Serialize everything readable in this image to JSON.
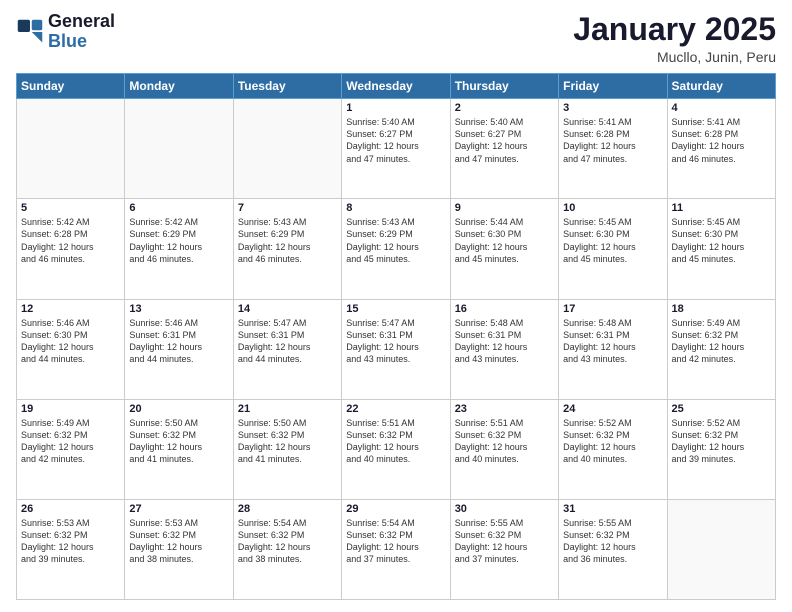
{
  "logo": {
    "line1": "General",
    "line2": "Blue"
  },
  "title": "January 2025",
  "subtitle": "Mucllo, Junin, Peru",
  "days_of_week": [
    "Sunday",
    "Monday",
    "Tuesday",
    "Wednesday",
    "Thursday",
    "Friday",
    "Saturday"
  ],
  "weeks": [
    [
      {
        "day": "",
        "info": ""
      },
      {
        "day": "",
        "info": ""
      },
      {
        "day": "",
        "info": ""
      },
      {
        "day": "1",
        "info": "Sunrise: 5:40 AM\nSunset: 6:27 PM\nDaylight: 12 hours\nand 47 minutes."
      },
      {
        "day": "2",
        "info": "Sunrise: 5:40 AM\nSunset: 6:27 PM\nDaylight: 12 hours\nand 47 minutes."
      },
      {
        "day": "3",
        "info": "Sunrise: 5:41 AM\nSunset: 6:28 PM\nDaylight: 12 hours\nand 47 minutes."
      },
      {
        "day": "4",
        "info": "Sunrise: 5:41 AM\nSunset: 6:28 PM\nDaylight: 12 hours\nand 46 minutes."
      }
    ],
    [
      {
        "day": "5",
        "info": "Sunrise: 5:42 AM\nSunset: 6:28 PM\nDaylight: 12 hours\nand 46 minutes."
      },
      {
        "day": "6",
        "info": "Sunrise: 5:42 AM\nSunset: 6:29 PM\nDaylight: 12 hours\nand 46 minutes."
      },
      {
        "day": "7",
        "info": "Sunrise: 5:43 AM\nSunset: 6:29 PM\nDaylight: 12 hours\nand 46 minutes."
      },
      {
        "day": "8",
        "info": "Sunrise: 5:43 AM\nSunset: 6:29 PM\nDaylight: 12 hours\nand 45 minutes."
      },
      {
        "day": "9",
        "info": "Sunrise: 5:44 AM\nSunset: 6:30 PM\nDaylight: 12 hours\nand 45 minutes."
      },
      {
        "day": "10",
        "info": "Sunrise: 5:45 AM\nSunset: 6:30 PM\nDaylight: 12 hours\nand 45 minutes."
      },
      {
        "day": "11",
        "info": "Sunrise: 5:45 AM\nSunset: 6:30 PM\nDaylight: 12 hours\nand 45 minutes."
      }
    ],
    [
      {
        "day": "12",
        "info": "Sunrise: 5:46 AM\nSunset: 6:30 PM\nDaylight: 12 hours\nand 44 minutes."
      },
      {
        "day": "13",
        "info": "Sunrise: 5:46 AM\nSunset: 6:31 PM\nDaylight: 12 hours\nand 44 minutes."
      },
      {
        "day": "14",
        "info": "Sunrise: 5:47 AM\nSunset: 6:31 PM\nDaylight: 12 hours\nand 44 minutes."
      },
      {
        "day": "15",
        "info": "Sunrise: 5:47 AM\nSunset: 6:31 PM\nDaylight: 12 hours\nand 43 minutes."
      },
      {
        "day": "16",
        "info": "Sunrise: 5:48 AM\nSunset: 6:31 PM\nDaylight: 12 hours\nand 43 minutes."
      },
      {
        "day": "17",
        "info": "Sunrise: 5:48 AM\nSunset: 6:31 PM\nDaylight: 12 hours\nand 43 minutes."
      },
      {
        "day": "18",
        "info": "Sunrise: 5:49 AM\nSunset: 6:32 PM\nDaylight: 12 hours\nand 42 minutes."
      }
    ],
    [
      {
        "day": "19",
        "info": "Sunrise: 5:49 AM\nSunset: 6:32 PM\nDaylight: 12 hours\nand 42 minutes."
      },
      {
        "day": "20",
        "info": "Sunrise: 5:50 AM\nSunset: 6:32 PM\nDaylight: 12 hours\nand 41 minutes."
      },
      {
        "day": "21",
        "info": "Sunrise: 5:50 AM\nSunset: 6:32 PM\nDaylight: 12 hours\nand 41 minutes."
      },
      {
        "day": "22",
        "info": "Sunrise: 5:51 AM\nSunset: 6:32 PM\nDaylight: 12 hours\nand 40 minutes."
      },
      {
        "day": "23",
        "info": "Sunrise: 5:51 AM\nSunset: 6:32 PM\nDaylight: 12 hours\nand 40 minutes."
      },
      {
        "day": "24",
        "info": "Sunrise: 5:52 AM\nSunset: 6:32 PM\nDaylight: 12 hours\nand 40 minutes."
      },
      {
        "day": "25",
        "info": "Sunrise: 5:52 AM\nSunset: 6:32 PM\nDaylight: 12 hours\nand 39 minutes."
      }
    ],
    [
      {
        "day": "26",
        "info": "Sunrise: 5:53 AM\nSunset: 6:32 PM\nDaylight: 12 hours\nand 39 minutes."
      },
      {
        "day": "27",
        "info": "Sunrise: 5:53 AM\nSunset: 6:32 PM\nDaylight: 12 hours\nand 38 minutes."
      },
      {
        "day": "28",
        "info": "Sunrise: 5:54 AM\nSunset: 6:32 PM\nDaylight: 12 hours\nand 38 minutes."
      },
      {
        "day": "29",
        "info": "Sunrise: 5:54 AM\nSunset: 6:32 PM\nDaylight: 12 hours\nand 37 minutes."
      },
      {
        "day": "30",
        "info": "Sunrise: 5:55 AM\nSunset: 6:32 PM\nDaylight: 12 hours\nand 37 minutes."
      },
      {
        "day": "31",
        "info": "Sunrise: 5:55 AM\nSunset: 6:32 PM\nDaylight: 12 hours\nand 36 minutes."
      },
      {
        "day": "",
        "info": ""
      }
    ]
  ]
}
